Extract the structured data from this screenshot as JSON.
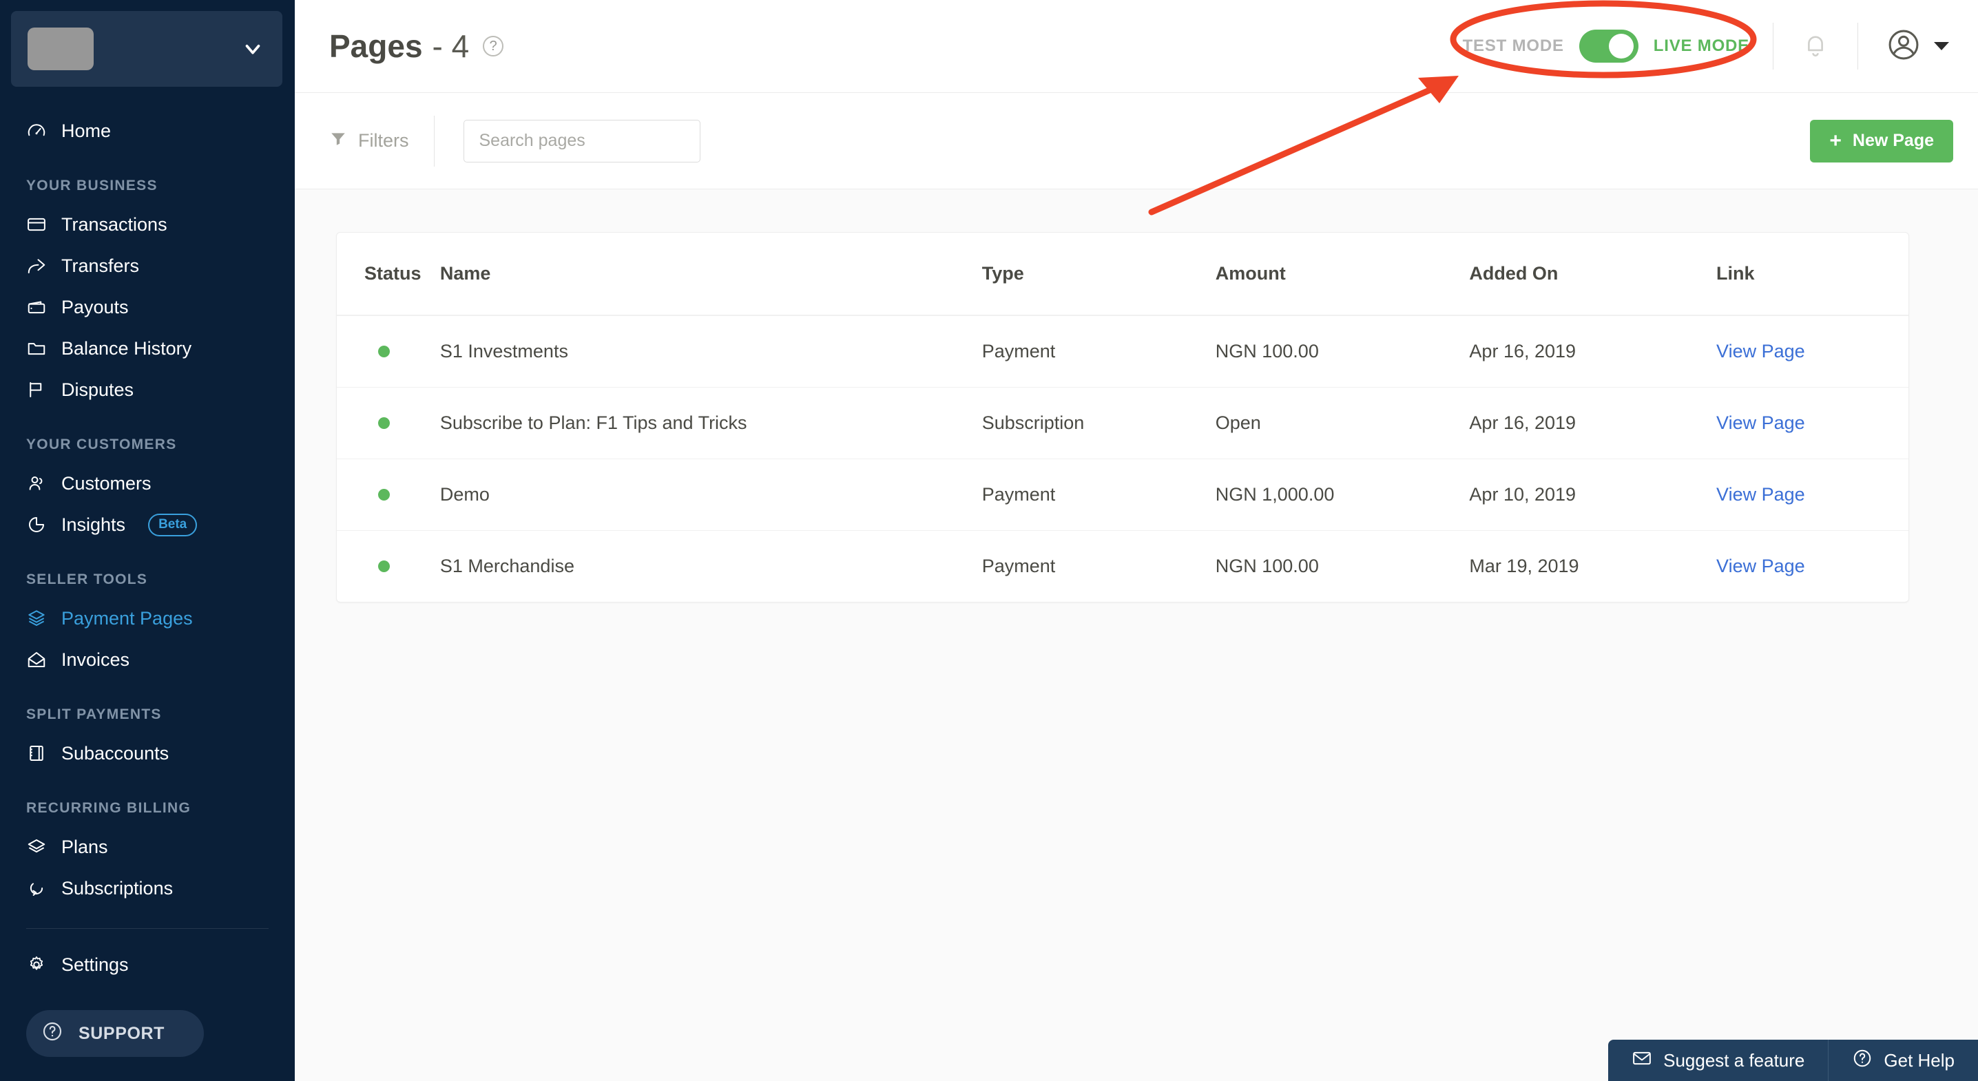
{
  "sidebar": {
    "brand": {
      "logo_placeholder": "",
      "chevron_icon": "chevron-down-icon"
    },
    "home": {
      "label": "Home",
      "icon": "speedometer-icon"
    },
    "sections": [
      {
        "label": "YOUR BUSINESS",
        "items": [
          {
            "label": "Transactions",
            "icon": "credit-card-icon"
          },
          {
            "label": "Transfers",
            "icon": "arrow-share-icon"
          },
          {
            "label": "Payouts",
            "icon": "wallet-icon"
          },
          {
            "label": "Balance History",
            "icon": "folder-icon"
          },
          {
            "label": "Disputes",
            "icon": "flag-icon"
          }
        ]
      },
      {
        "label": "YOUR CUSTOMERS",
        "items": [
          {
            "label": "Customers",
            "icon": "user-group-icon"
          },
          {
            "label": "Insights",
            "icon": "pie-chart-icon",
            "badge": "Beta"
          }
        ]
      },
      {
        "label": "SELLER TOOLS",
        "items": [
          {
            "label": "Payment Pages",
            "icon": "open-box-icon",
            "active": true
          },
          {
            "label": "Invoices",
            "icon": "open-envelope-icon"
          }
        ]
      },
      {
        "label": "SPLIT PAYMENTS",
        "items": [
          {
            "label": "Subaccounts",
            "icon": "notebook-icon"
          }
        ]
      },
      {
        "label": "RECURRING BILLING",
        "items": [
          {
            "label": "Plans",
            "icon": "layers-icon"
          },
          {
            "label": "Subscriptions",
            "icon": "refresh-loop-icon"
          }
        ]
      }
    ],
    "settings": {
      "label": "Settings",
      "icon": "gear-icon"
    },
    "support": {
      "label": "SUPPORT",
      "icon": "question-circle-icon"
    }
  },
  "header": {
    "title": "Pages",
    "count": "- 4",
    "help_icon": "question-circle-icon",
    "test_mode_label": "TEST MODE",
    "live_mode_label": "LIVE MODE",
    "toggle_state": "live",
    "notification_icon": "bell-icon",
    "avatar_icon": "user-avatar-icon",
    "account_caret_icon": "caret-down-icon"
  },
  "toolbar": {
    "filters_label": "Filters",
    "filters_icon": "funnel-icon",
    "search_placeholder": "Search pages",
    "search_value": "",
    "search_icon": "search-icon",
    "new_page_label": "New Page",
    "new_page_icon": "plus-icon"
  },
  "table": {
    "columns": [
      "Status",
      "Name",
      "Type",
      "Amount",
      "Added On",
      "Link"
    ],
    "rows": [
      {
        "status": "active",
        "name": "S1 Investments",
        "type": "Payment",
        "amount": "NGN 100.00",
        "added_on": "Apr 16, 2019",
        "link": "View Page"
      },
      {
        "status": "active",
        "name": "Subscribe to Plan: F1 Tips and Tricks",
        "type": "Subscription",
        "amount": "Open",
        "added_on": "Apr 16, 2019",
        "link": "View Page"
      },
      {
        "status": "active",
        "name": "Demo",
        "type": "Payment",
        "amount": "NGN 1,000.00",
        "added_on": "Apr 10, 2019",
        "link": "View Page"
      },
      {
        "status": "active",
        "name": "S1 Merchandise",
        "type": "Payment",
        "amount": "NGN 100.00",
        "added_on": "Mar 19, 2019",
        "link": "View Page"
      }
    ]
  },
  "help_widget": {
    "suggest_label": "Suggest a feature",
    "suggest_icon": "envelope-icon",
    "get_help_label": "Get Help",
    "get_help_icon": "question-circle-icon"
  },
  "annotation": {
    "highlight_shape": "ellipse",
    "arrow": "arrow-pointing-to-mode-toggle",
    "color": "#ee4326"
  },
  "colors": {
    "sidebar_bg": "#0a1f38",
    "accent_blue": "#3aa0dd",
    "green": "#5cb85c",
    "link_blue": "#3b6fd6",
    "annotation_red": "#ee4326"
  }
}
